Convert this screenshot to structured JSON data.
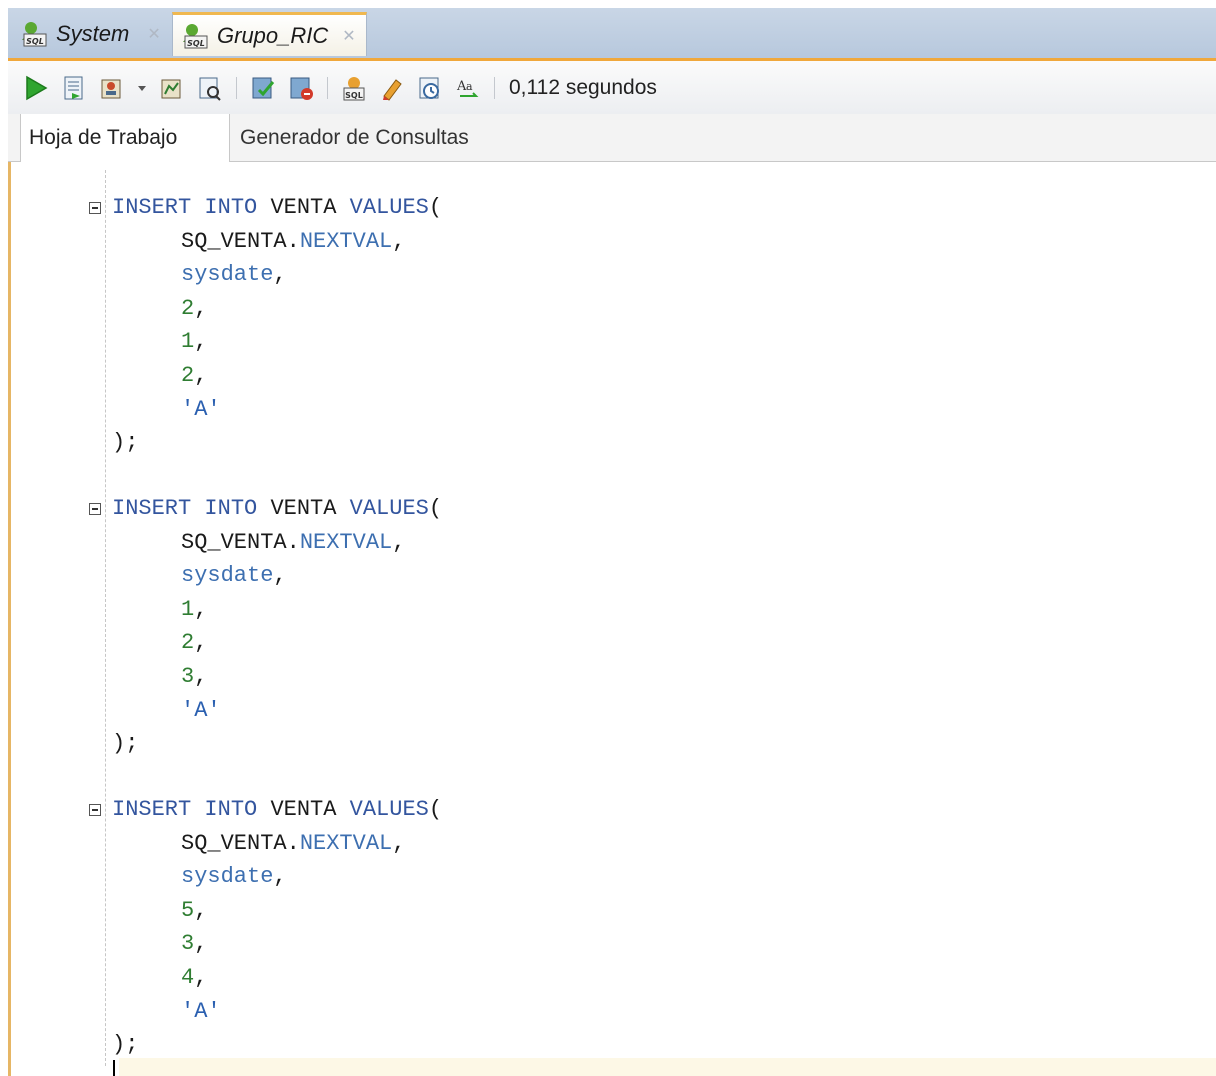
{
  "tabs": [
    {
      "label": "System",
      "active": false
    },
    {
      "label": "Grupo_RIC",
      "active": true
    }
  ],
  "toolbar": {
    "icons": [
      "run-statement-icon",
      "run-script-icon",
      "autotrace-icon",
      "dropdown-arrow-icon",
      "explain-plan-icon",
      "sql-tuning-icon",
      "commit-icon",
      "rollback-icon",
      "unshared-sql-icon",
      "clear-icon",
      "sql-history-icon",
      "format-case-icon"
    ],
    "status": "0,112 segundos"
  },
  "subtabs": {
    "worksheet": "Hoja de Trabajo",
    "query_builder": "Generador de Consultas"
  },
  "editor": {
    "blocks": [
      {
        "table": "VENTA",
        "seq": "SQ_VENTA",
        "nextval": "NEXTVAL",
        "date": "sysdate",
        "values": [
          "2",
          "1",
          "2"
        ],
        "str": "'A'"
      },
      {
        "table": "VENTA",
        "seq": "SQ_VENTA",
        "nextval": "NEXTVAL",
        "date": "sysdate",
        "values": [
          "1",
          "2",
          "3"
        ],
        "str": "'A'"
      },
      {
        "table": "VENTA",
        "seq": "SQ_VENTA",
        "nextval": "NEXTVAL",
        "date": "sysdate",
        "values": [
          "5",
          "3",
          "4"
        ],
        "str": "'A'"
      }
    ],
    "keywords": {
      "insert": "INSERT",
      "into": "INTO",
      "values": "VALUES"
    }
  },
  "colors": {
    "accent": "#f0a83c",
    "keyword": "#33559e",
    "number": "#2f7d32"
  }
}
